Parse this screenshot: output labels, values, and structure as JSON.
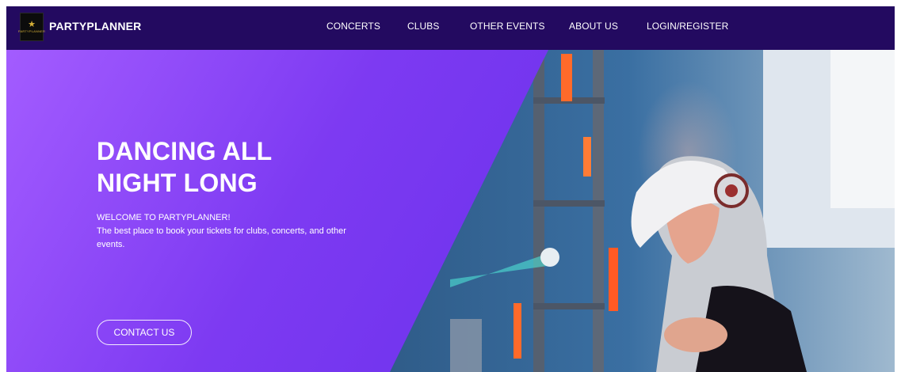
{
  "nav": {
    "brand": "PARTYPLANNER",
    "logo_text": "PARTYPLANNER",
    "links": [
      "CONCERTS",
      "CLUBS",
      "OTHER EVENTS",
      "ABOUT US",
      "LOGIN/REGISTER"
    ]
  },
  "hero": {
    "title_line1": "DANCING ALL",
    "title_line2": "NIGHT LONG",
    "welcome": "WELCOME TO PARTYPLANNER!",
    "description": "The best place to book your tickets for clubs, concerts, and other events.",
    "cta_label": "CONTACT US"
  },
  "colors": {
    "nav_bg": "#230a60",
    "hero_start": "#a35cff",
    "hero_end": "#5b2ae6"
  }
}
